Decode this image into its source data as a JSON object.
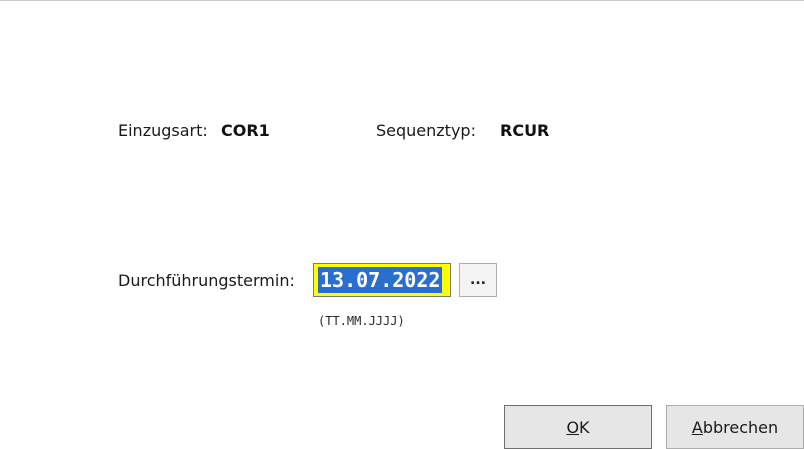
{
  "dialog": {
    "info": {
      "einzugsart_label": "Einzugsart:",
      "einzugsart_value": "COR1",
      "sequenztyp_label": "Sequenztyp:",
      "sequenztyp_value": "RCUR"
    },
    "termin": {
      "label": "Durchführungstermin:",
      "value": "13.07.2022",
      "browse_label": "...",
      "format_hint": "(TT.MM.JJJJ)"
    },
    "buttons": {
      "ok_label": "OK",
      "cancel_label": "Abbrechen"
    },
    "colors": {
      "date_field_background": "#ffff00",
      "selection_highlight": "#2a6ed0"
    },
    "icons": {
      "browse": "ellipsis-icon"
    }
  }
}
